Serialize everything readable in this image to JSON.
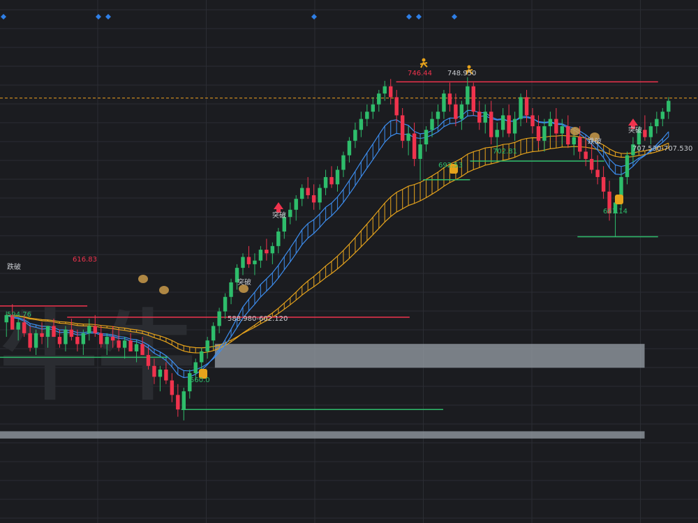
{
  "chart_data": {
    "type": "candlestick",
    "colors": {
      "background": "#1b1c20",
      "grid": "#2b2d33",
      "up": "#2ebd6b",
      "down": "#f0334d",
      "resistance": "#f0334d",
      "support": "#2ebd6b",
      "ribbon_fast": "#3d8ef0",
      "ribbon_slow": "#e6a31c",
      "current_price": "#f0a020",
      "zone": "#9aa0a8",
      "marker": "#2f7fe6"
    },
    "labels": {
      "high_left": "746.44",
      "high_right": "748.950",
      "mid_low": "692.53",
      "mid_support": "702.81",
      "right_low": "661.14",
      "left_res": "616.83",
      "left_sup": "594.76",
      "bottom_low": "560.0",
      "zone_low": "588.980-602.120",
      "zone_right": "707.530-707.530",
      "signal_breakout": "突破",
      "signal_breakdown": "跌破"
    },
    "watermark": "牛牛",
    "y_range": [
      515,
      780
    ],
    "resistance_levels": [
      {
        "value": 746.44,
        "from": 0.59,
        "to": 0.98
      },
      {
        "value": 616.83,
        "from": 0.1,
        "to": 0.61
      },
      {
        "value": 623.0,
        "from": 0.0,
        "to": 0.13
      }
    ],
    "support_levels": [
      {
        "value": 692.53,
        "from": 0.63,
        "to": 0.7
      },
      {
        "value": 702.81,
        "from": 0.7,
        "to": 0.9
      },
      {
        "value": 661.14,
        "from": 0.86,
        "to": 0.98
      },
      {
        "value": 594.76,
        "from": 0.0,
        "to": 0.25
      },
      {
        "value": 566.0,
        "from": 0.27,
        "to": 0.66
      }
    ],
    "current_price": 737.5,
    "zones": [
      {
        "low": 588.98,
        "high": 602.12,
        "from": 0.32,
        "to": 0.96
      },
      {
        "low": 550.0,
        "high": 554.0,
        "from": 0.0,
        "to": 0.96
      }
    ],
    "candles": [
      [
        614,
        620,
        606,
        618
      ],
      [
        618,
        624,
        612,
        610
      ],
      [
        610,
        616,
        604,
        614
      ],
      [
        614,
        618,
        606,
        608
      ],
      [
        608,
        612,
        598,
        600
      ],
      [
        600,
        610,
        596,
        608
      ],
      [
        608,
        614,
        602,
        606
      ],
      [
        606,
        612,
        600,
        612
      ],
      [
        612,
        616,
        606,
        606
      ],
      [
        606,
        610,
        600,
        602
      ],
      [
        602,
        612,
        598,
        610
      ],
      [
        610,
        616,
        604,
        606
      ],
      [
        606,
        610,
        598,
        602
      ],
      [
        602,
        610,
        596,
        608
      ],
      [
        608,
        616,
        604,
        612
      ],
      [
        612,
        618,
        606,
        608
      ],
      [
        608,
        612,
        600,
        602
      ],
      [
        602,
        608,
        596,
        606
      ],
      [
        606,
        612,
        600,
        604
      ],
      [
        604,
        610,
        598,
        600
      ],
      [
        600,
        606,
        594,
        604
      ],
      [
        604,
        608,
        598,
        598
      ],
      [
        598,
        604,
        592,
        602
      ],
      [
        602,
        606,
        596,
        596
      ],
      [
        596,
        600,
        588,
        590
      ],
      [
        590,
        594,
        580,
        584
      ],
      [
        584,
        590,
        576,
        588
      ],
      [
        588,
        592,
        580,
        582
      ],
      [
        582,
        586,
        570,
        574
      ],
      [
        574,
        580,
        562,
        566
      ],
      [
        566,
        578,
        560,
        576
      ],
      [
        576,
        588,
        572,
        586
      ],
      [
        586,
        594,
        582,
        592
      ],
      [
        592,
        600,
        588,
        598
      ],
      [
        598,
        606,
        594,
        604
      ],
      [
        604,
        614,
        600,
        612
      ],
      [
        612,
        622,
        608,
        620
      ],
      [
        620,
        630,
        616,
        628
      ],
      [
        628,
        638,
        624,
        636
      ],
      [
        636,
        646,
        632,
        644
      ],
      [
        644,
        652,
        640,
        650
      ],
      [
        650,
        656,
        644,
        646
      ],
      [
        646,
        652,
        640,
        648
      ],
      [
        648,
        656,
        644,
        654
      ],
      [
        654,
        660,
        648,
        652
      ],
      [
        652,
        658,
        646,
        656
      ],
      [
        656,
        666,
        652,
        664
      ],
      [
        664,
        674,
        660,
        672
      ],
      [
        672,
        680,
        668,
        676
      ],
      [
        676,
        684,
        670,
        682
      ],
      [
        682,
        690,
        678,
        688
      ],
      [
        688,
        694,
        682,
        684
      ],
      [
        684,
        690,
        676,
        680
      ],
      [
        680,
        690,
        676,
        688
      ],
      [
        688,
        698,
        684,
        694
      ],
      [
        694,
        700,
        688,
        690
      ],
      [
        690,
        700,
        686,
        698
      ],
      [
        698,
        708,
        694,
        706
      ],
      [
        706,
        716,
        702,
        714
      ],
      [
        714,
        724,
        710,
        720
      ],
      [
        720,
        730,
        716,
        726
      ],
      [
        726,
        734,
        722,
        730
      ],
      [
        730,
        738,
        726,
        734
      ],
      [
        734,
        742,
        730,
        740
      ],
      [
        740,
        747,
        736,
        744
      ],
      [
        744,
        748,
        734,
        738
      ],
      [
        738,
        742,
        724,
        728
      ],
      [
        728,
        732,
        710,
        714
      ],
      [
        714,
        722,
        706,
        718
      ],
      [
        718,
        724,
        700,
        704
      ],
      [
        704,
        716,
        692,
        712
      ],
      [
        712,
        722,
        708,
        720
      ],
      [
        720,
        730,
        716,
        726
      ],
      [
        726,
        734,
        722,
        730
      ],
      [
        730,
        742,
        726,
        740
      ],
      [
        740,
        746,
        730,
        734
      ],
      [
        734,
        740,
        722,
        726
      ],
      [
        726,
        736,
        720,
        734
      ],
      [
        734,
        749,
        730,
        744
      ],
      [
        744,
        746,
        728,
        730
      ],
      [
        730,
        736,
        720,
        724
      ],
      [
        724,
        734,
        718,
        730
      ],
      [
        730,
        736,
        712,
        716
      ],
      [
        716,
        724,
        708,
        720
      ],
      [
        720,
        732,
        716,
        728
      ],
      [
        728,
        734,
        716,
        718
      ],
      [
        718,
        730,
        714,
        726
      ],
      [
        726,
        740,
        722,
        738
      ],
      [
        738,
        742,
        724,
        728
      ],
      [
        728,
        732,
        718,
        722
      ],
      [
        722,
        728,
        710,
        714
      ],
      [
        714,
        726,
        708,
        722
      ],
      [
        722,
        730,
        716,
        726
      ],
      [
        726,
        732,
        714,
        718
      ],
      [
        718,
        726,
        712,
        722
      ],
      [
        722,
        728,
        710,
        712
      ],
      [
        712,
        720,
        706,
        716
      ],
      [
        716,
        722,
        704,
        708
      ],
      [
        708,
        716,
        700,
        704
      ],
      [
        704,
        712,
        696,
        698
      ],
      [
        698,
        706,
        690,
        694
      ],
      [
        694,
        700,
        682,
        686
      ],
      [
        686,
        692,
        670,
        674
      ],
      [
        674,
        682,
        661,
        680
      ],
      [
        680,
        696,
        676,
        694
      ],
      [
        694,
        708,
        690,
        706
      ],
      [
        706,
        716,
        702,
        712
      ],
      [
        712,
        722,
        708,
        720
      ],
      [
        720,
        728,
        714,
        716
      ],
      [
        716,
        724,
        712,
        722
      ],
      [
        722,
        730,
        718,
        726
      ],
      [
        726,
        732,
        722,
        730
      ],
      [
        730,
        738,
        726,
        736
      ]
    ]
  }
}
